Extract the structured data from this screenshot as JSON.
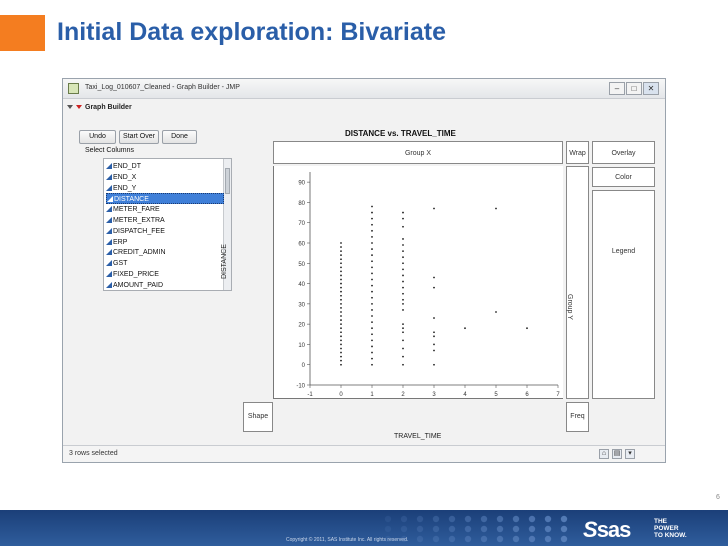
{
  "slide": {
    "title": "Initial Data exploration: Bivariate",
    "number": "6",
    "copyright": "Copyright © 2011, SAS Institute Inc. All rights reserved.",
    "logo_text": "sas",
    "tagline": "THE\nPOWER\nTO KNOW."
  },
  "window": {
    "title": "Taxi_Log_010607_Cleaned - Graph Builder - JMP",
    "min_glyph": "–",
    "max_glyph": "□",
    "close_glyph": "✕"
  },
  "graph_builder": {
    "header": "Graph Builder",
    "buttons": {
      "undo": "Undo",
      "start_over": "Start Over",
      "done": "Done"
    },
    "select_columns_label": "Select Columns",
    "columns": [
      "END_DT",
      "END_X",
      "END_Y",
      "DISTANCE",
      "METER_FARE",
      "METER_EXTRA",
      "DISPATCH_FEE",
      "ERP",
      "CREDIT_ADMIN",
      "GST",
      "FIXED_PRICE",
      "AMOUNT_PAID"
    ],
    "selected_column": "DISTANCE",
    "graph_title": "DISTANCE vs. TRAVEL_TIME",
    "zones": {
      "group_x": "Group X",
      "group_y": "Group Y",
      "wrap": "Wrap",
      "overlay": "Overlay",
      "color": "Color",
      "legend": "Legend",
      "shape": "Shape",
      "freq": "Freq"
    },
    "status": "3 rows selected"
  },
  "chart_data": {
    "type": "scatter",
    "title": "DISTANCE vs. TRAVEL_TIME",
    "xlabel": "TRAVEL_TIME",
    "ylabel": "DISTANCE",
    "xlim": [
      -1,
      7
    ],
    "ylim": [
      -10,
      95
    ],
    "x_ticks": [
      -1,
      0,
      1,
      2,
      3,
      4,
      5,
      6,
      7
    ],
    "y_ticks": [
      -10,
      0,
      10,
      20,
      30,
      40,
      50,
      60,
      70,
      80,
      90
    ],
    "grid": false,
    "columns": [
      {
        "x": 0,
        "ys": [
          0,
          2,
          4,
          6,
          8,
          10,
          12,
          14,
          16,
          18,
          20,
          22,
          24,
          26,
          28,
          30,
          32,
          34,
          36,
          38,
          40,
          42,
          44,
          46,
          48,
          50,
          52,
          54,
          56,
          58,
          60
        ]
      },
      {
        "x": 1,
        "ys": [
          0,
          3,
          6,
          9,
          12,
          15,
          18,
          21,
          24,
          27,
          30,
          33,
          36,
          39,
          42,
          45,
          48,
          51,
          54,
          57,
          60,
          63,
          66,
          69,
          72,
          75,
          78
        ]
      },
      {
        "x": 2,
        "ys": [
          0,
          4,
          8,
          12,
          16,
          18,
          20,
          27,
          30,
          32,
          35,
          38,
          41,
          44,
          47,
          50,
          53,
          56,
          59,
          62,
          68,
          72,
          75
        ]
      },
      {
        "x": 3,
        "ys": [
          0,
          7,
          10,
          14,
          16,
          23,
          38,
          43,
          77
        ]
      },
      {
        "x": 4,
        "ys": [
          18
        ]
      },
      {
        "x": 5,
        "ys": [
          26,
          77
        ]
      },
      {
        "x": 6,
        "ys": [
          18
        ]
      }
    ]
  }
}
